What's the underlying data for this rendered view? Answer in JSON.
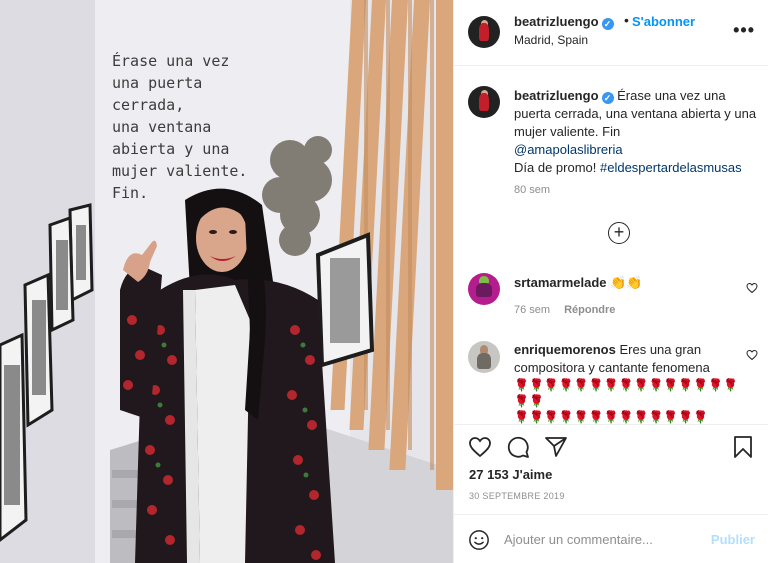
{
  "photo": {
    "quote": "Érase una vez\nuna puerta\ncerrada,\nuna ventana\nabierta y una\nmujer valiente.\nFin."
  },
  "header": {
    "username": "beatrizluengo",
    "verified_mark": "✓",
    "dot": "•",
    "follow_label": "S'abonner",
    "location": "Madrid, Spain",
    "more_label": "•••"
  },
  "caption": {
    "username": "beatrizluengo",
    "text_1": "Érase una vez una puerta cerrada, una ventana abierta y una mujer valiente. Fin",
    "mention": "@amapolaslibreria",
    "text_2": "Día de promo!",
    "hashtag": "#eldespertardelasmusas",
    "time": "80 sem"
  },
  "load_more_label": "+",
  "comments": [
    {
      "username": "srtamarmelade",
      "text": "👏👏",
      "time": "76 sem",
      "reply_label": "Répondre"
    },
    {
      "username": "enriquemorenos",
      "text": "Eres una gran compositora y cantante fenomena",
      "roses_line_1": "🌹🌹🌹🌹🌹🌹🌹🌹🌹🌹🌹🌹🌹🌹🌹🌹🌹",
      "roses_line_2": "🌹🌹🌹🌹🌹🌹🌹🌹🌹🌹🌹🌹🌹"
    }
  ],
  "icons": {
    "like": "heart-icon",
    "comment": "comment-icon",
    "share": "send-icon",
    "save": "bookmark-icon",
    "emoji": "smiley-icon",
    "comment_like": "small-heart-icon"
  },
  "stats": {
    "likes": "27 153 J'aime",
    "date": "30 SEPTEMBRE 2019"
  },
  "composer": {
    "placeholder": "Ajouter un commentaire...",
    "publish_label": "Publier"
  },
  "colors": {
    "accent": "#0095f6",
    "publish_disabled": "#b2dffc",
    "link": "#00376b",
    "muted": "#8e8e8e",
    "verified": "#3897f0"
  }
}
